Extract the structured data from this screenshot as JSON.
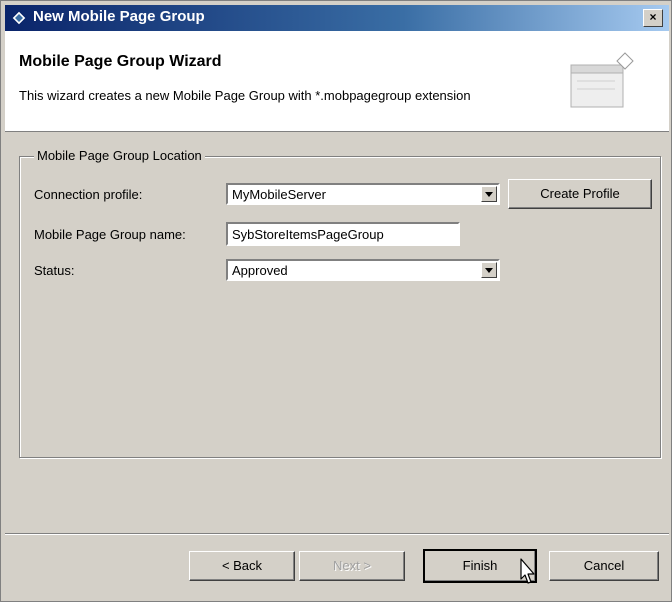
{
  "window": {
    "title": "New Mobile Page Group",
    "close_glyph": "×"
  },
  "header": {
    "title": "Mobile Page Group Wizard",
    "description": "This wizard creates a new Mobile Page Group with *.mobpagegroup extension"
  },
  "group": {
    "legend": "Mobile Page Group Location",
    "connection_profile": {
      "label": "Connection profile:",
      "value": "MyMobileServer"
    },
    "create_profile_label": "Create Profile",
    "page_group_name": {
      "label": "Mobile Page Group name:",
      "value": "SybStoreItemsPageGroup"
    },
    "status": {
      "label": "Status:",
      "value": "Approved"
    }
  },
  "footer": {
    "back_label": "< Back",
    "next_label": "Next >",
    "finish_label": "Finish",
    "cancel_label": "Cancel"
  },
  "colors": {
    "titlebar_start": "#0a246a",
    "titlebar_end": "#a6caf0",
    "dialog_bg": "#d4d0c8"
  },
  "icons": [
    "window-diamond-icon",
    "close-icon",
    "wizard-banner-icon",
    "dropdown-arrow-icon",
    "mouse-pointer-icon"
  ]
}
